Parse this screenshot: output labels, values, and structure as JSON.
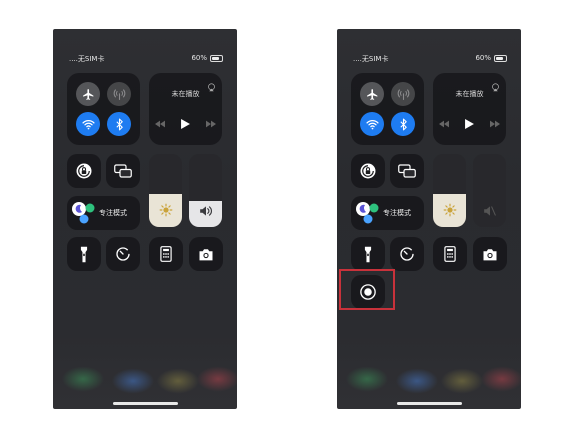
{
  "screens": [
    {
      "id": "left",
      "status": {
        "carrier": "....无SIM卡",
        "battery": "60%"
      },
      "media": {
        "title": "未在播放"
      },
      "focus": {
        "label": "专注模式"
      },
      "brightness_level": 0.45,
      "volume_level": 0.35,
      "volume_state": "on"
    },
    {
      "id": "right",
      "status": {
        "carrier": "....无SIM卡",
        "battery": "60%"
      },
      "media": {
        "title": "未在播放"
      },
      "focus": {
        "label": "专注模式"
      },
      "brightness_level": 0.45,
      "volume_level": 0,
      "volume_state": "muted",
      "extra_control": "screen-record-button"
    }
  ],
  "colors": {
    "accent_blue": "#1e7cf1",
    "highlight_red": "#c8323b",
    "slider_fill": "#e9e4d6"
  },
  "icons": [
    "airplane-icon",
    "cellular-icon",
    "wifi-icon",
    "bluetooth-icon",
    "airplay-icon",
    "rewind-icon",
    "play-icon",
    "forward-icon",
    "rotation-lock-icon",
    "screen-mirroring-icon",
    "sun-icon",
    "speaker-icon",
    "speaker-muted-icon",
    "moon-icon",
    "flashlight-icon",
    "timer-icon",
    "calculator-icon",
    "camera-icon",
    "screen-record-icon"
  ]
}
